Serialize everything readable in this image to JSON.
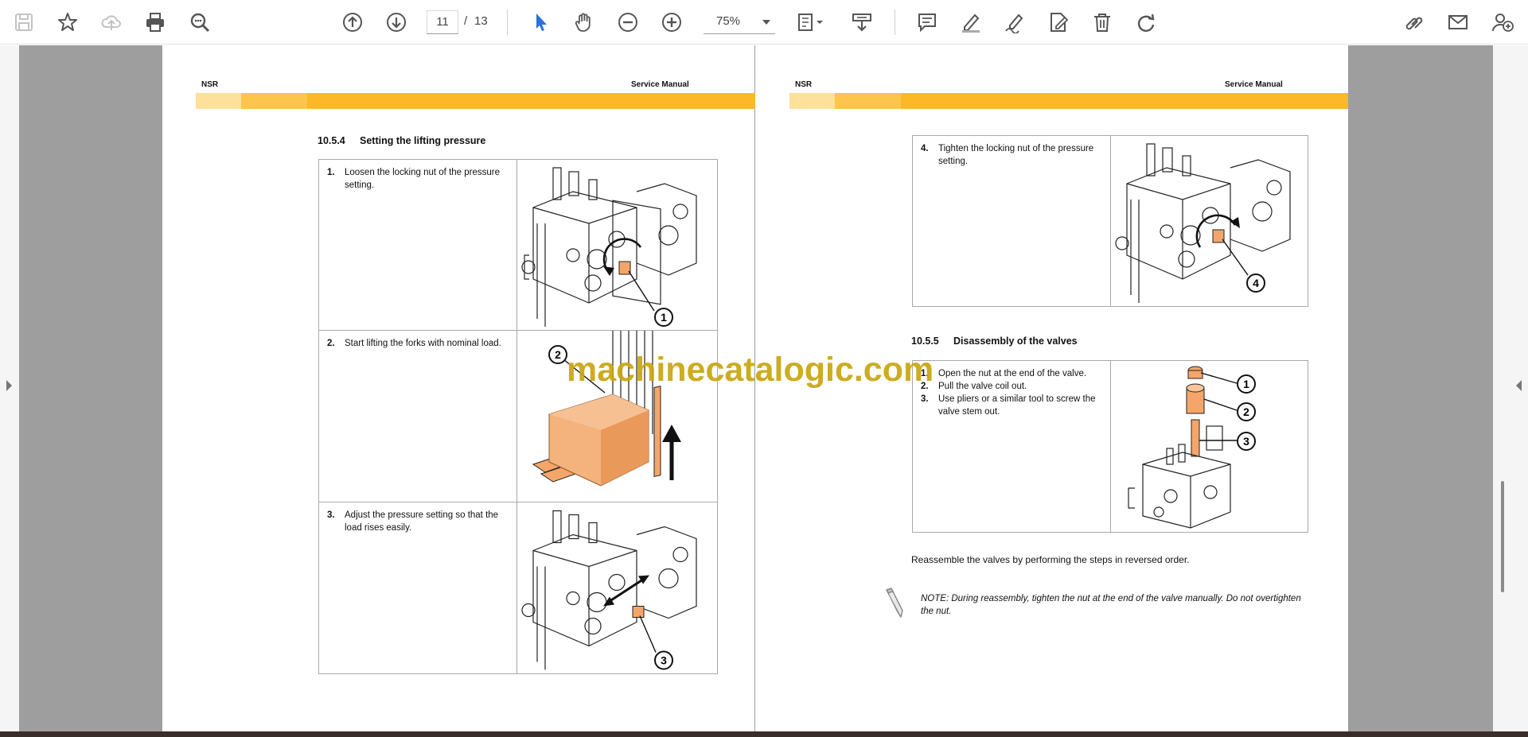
{
  "toolbar": {
    "icons": [
      "save-icon",
      "bookmark-star-icon",
      "cloud-upload-icon",
      "print-icon",
      "zoom-search-icon",
      "page-up-icon",
      "page-down-icon",
      "select-cursor-icon",
      "hand-pan-icon",
      "zoom-out-icon",
      "zoom-in-icon",
      "fit-page-icon",
      "scroll-mode-icon",
      "comment-icon",
      "highlight-pen-icon",
      "draw-sign-icon",
      "edit-text-icon",
      "delete-icon",
      "redo-icon",
      "share-link-icon",
      "email-icon",
      "add-user-icon"
    ],
    "current_page": "11",
    "page_separator": "/",
    "total_pages": "13",
    "zoom": "75%"
  },
  "pages": {
    "left": {
      "header_left": "NSR",
      "header_right": "Service Manual",
      "section_number": "10.5.4",
      "section_title": "Setting the lifting pressure",
      "steps": [
        {
          "num": "1.",
          "text": "Loosen the locking nut of the pressure setting.",
          "callout": "1"
        },
        {
          "num": "2.",
          "text": "Start lifting the forks with nominal load.",
          "callout": "2"
        },
        {
          "num": "3.",
          "text": "Adjust the pressure setting so that the load rises easily.",
          "callout": "3"
        }
      ]
    },
    "right": {
      "header_left": "NSR",
      "header_right": "Service Manual",
      "step4": {
        "num": "4.",
        "text": "Tighten the locking nut of the pressure setting.",
        "callout": "4"
      },
      "section_number": "10.5.5",
      "section_title": "Disassembly of the valves",
      "disassembly_steps": [
        {
          "num": "1.",
          "text": "Open the nut at the end of the valve."
        },
        {
          "num": "2.",
          "text": "Pull the valve coil out."
        },
        {
          "num": "3.",
          "text": "Use pliers or a similar tool to screw the valve stem out."
        }
      ],
      "disassembly_callouts": [
        "1",
        "2",
        "3"
      ],
      "reassemble_text": "Reassemble the valves by performing the steps in reversed order.",
      "note_text": "NOTE: During reassembly, tighten the nut at the end of the valve manually. Do not overtighten the nut."
    }
  },
  "watermark": "machinecatalogic.com",
  "colors": {
    "accent_orange": "#f4a66a",
    "band_light": "#fde09a",
    "band_mid": "#fcc64c",
    "band_dark": "#fbb829",
    "watermark": "#c9a510",
    "viewer_gray": "#9e9e9e"
  }
}
